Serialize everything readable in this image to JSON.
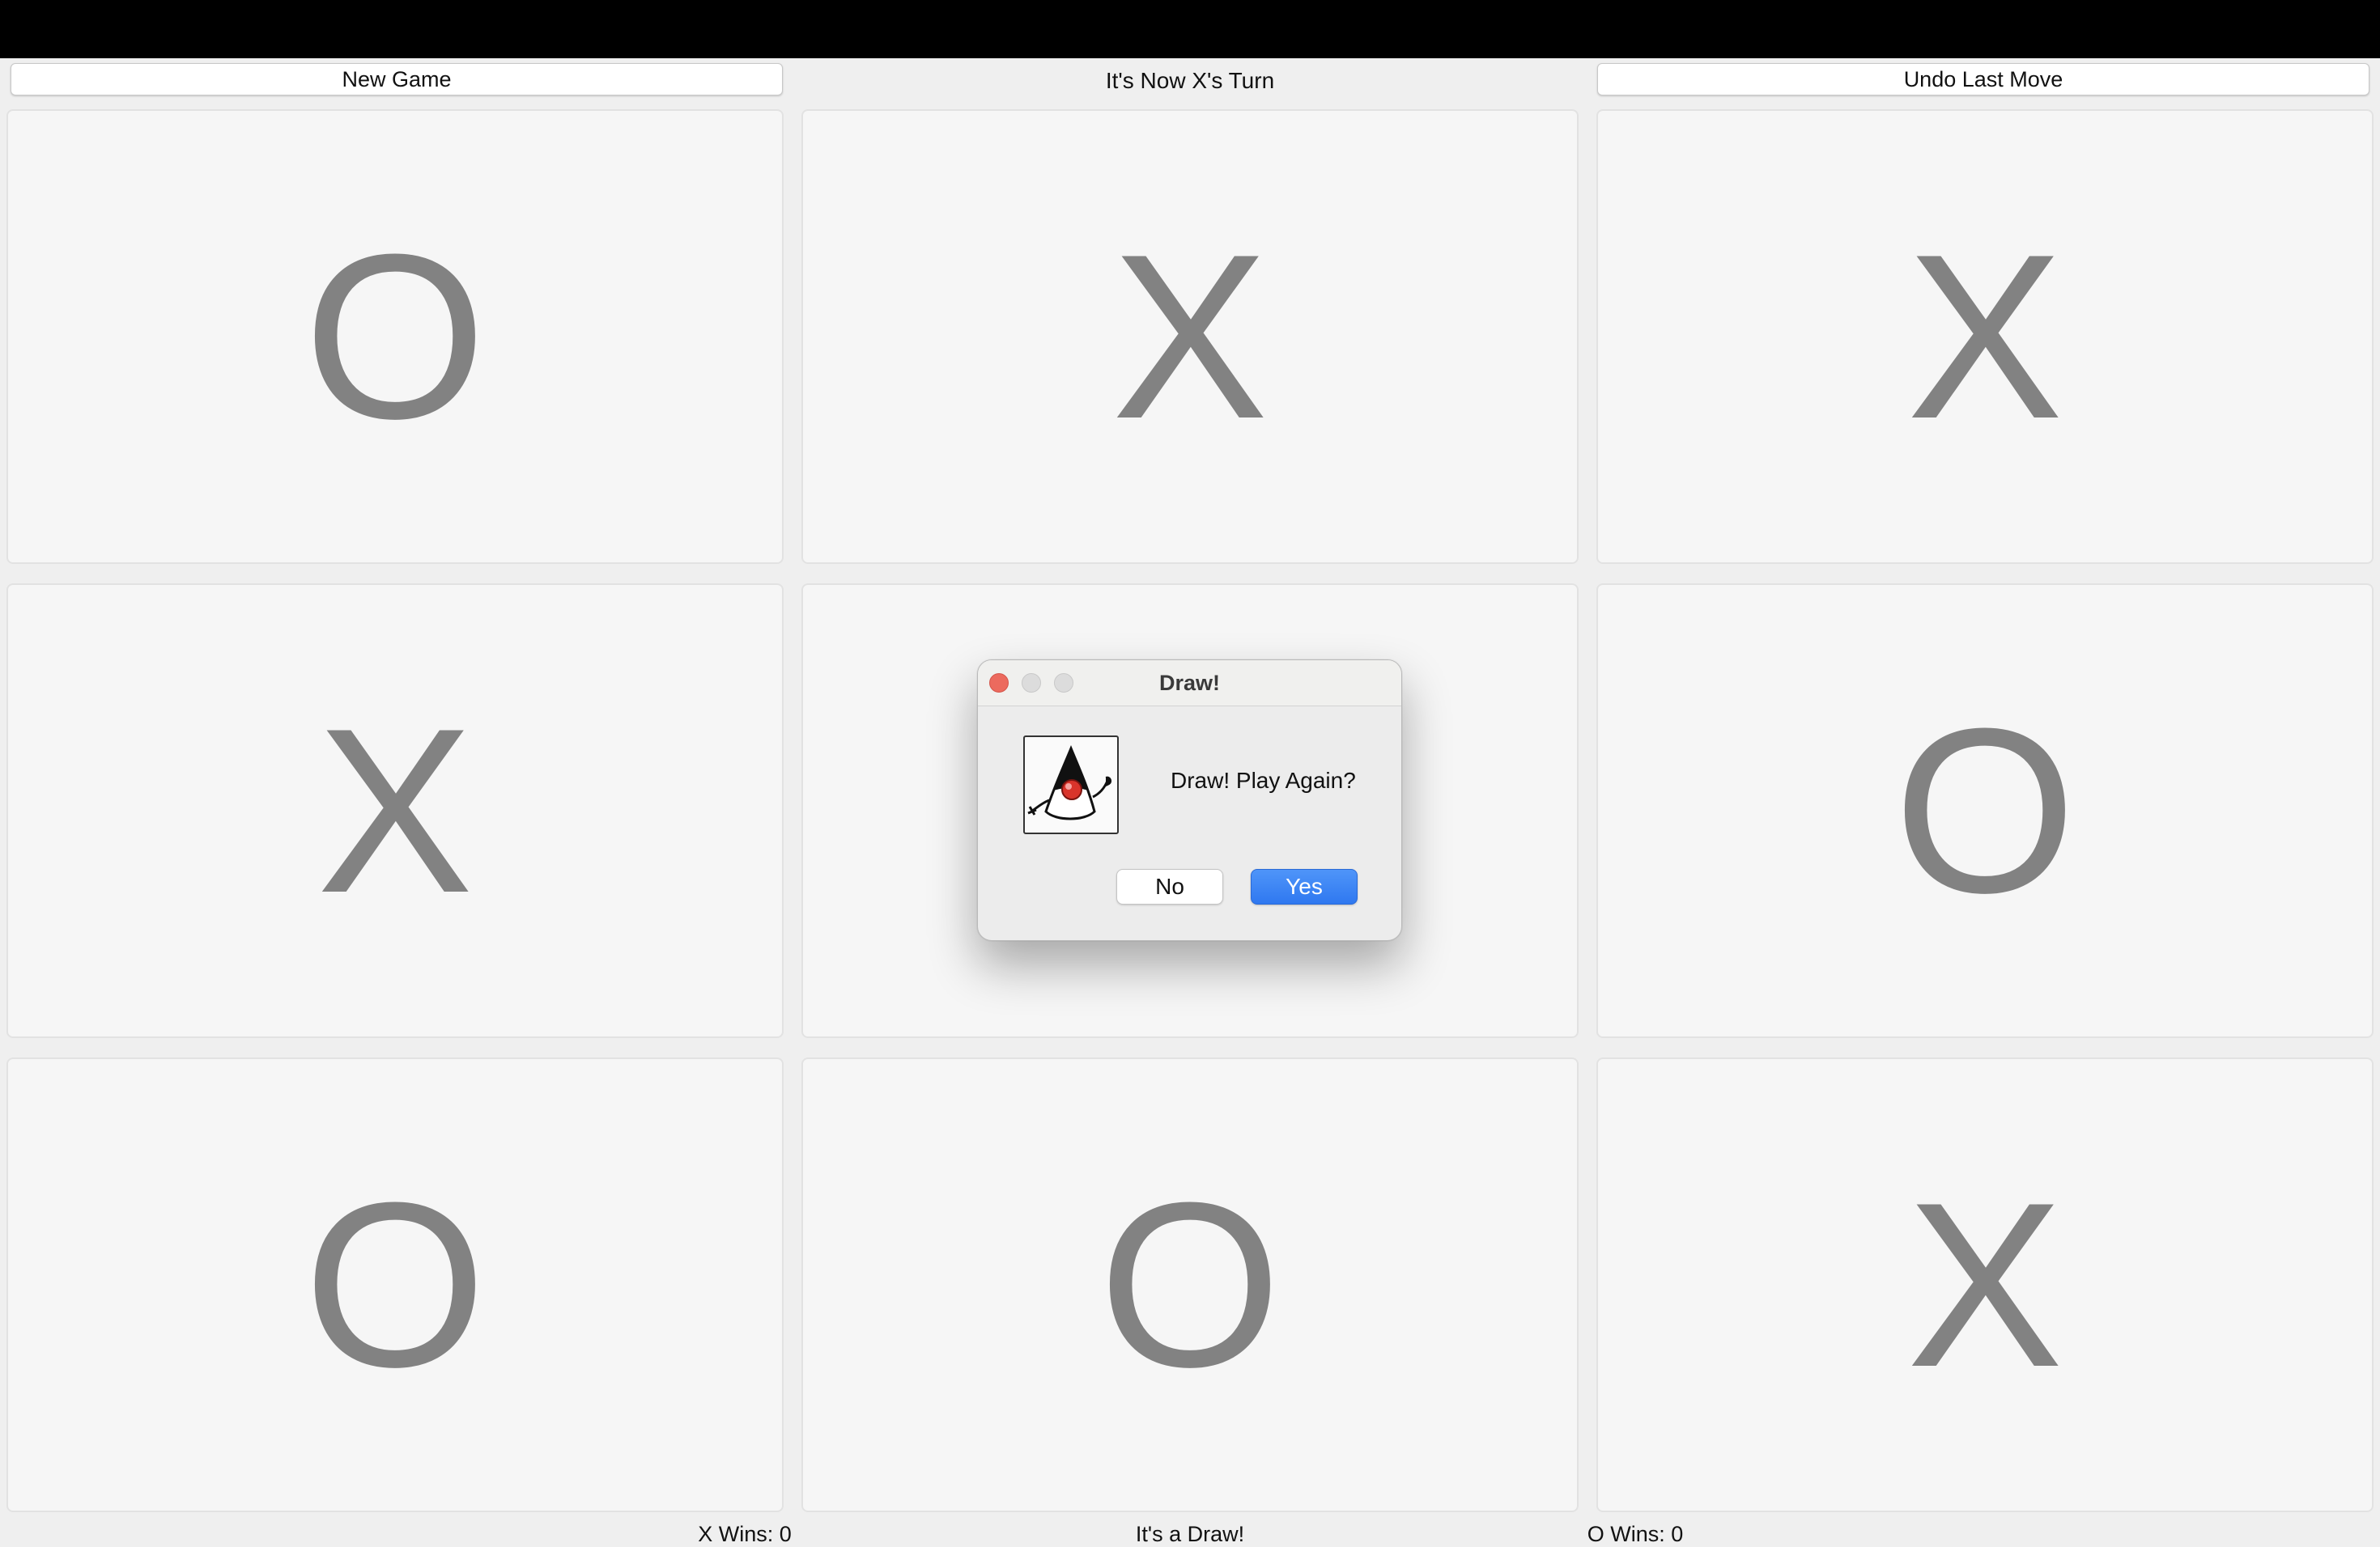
{
  "toolbar": {
    "new_game_label": "New Game",
    "turn_text": "It's Now X's Turn",
    "undo_label": "Undo Last Move"
  },
  "board": {
    "cells": [
      "O",
      "X",
      "X",
      "X",
      "",
      "O",
      "O",
      "O",
      "X"
    ]
  },
  "status": {
    "x_wins": "X Wins: 0",
    "result": "It's a Draw!",
    "o_wins": "O Wins: 0"
  },
  "dialog": {
    "title": "Draw!",
    "message": "Draw! Play Again?",
    "icon": "java-duke-icon",
    "no_label": "No",
    "yes_label": "Yes",
    "yes_color": "#3b82f6"
  },
  "colors": {
    "mark": "#828282",
    "cell_bg": "#f6f6f6",
    "close_button": "#ec6a5e"
  }
}
